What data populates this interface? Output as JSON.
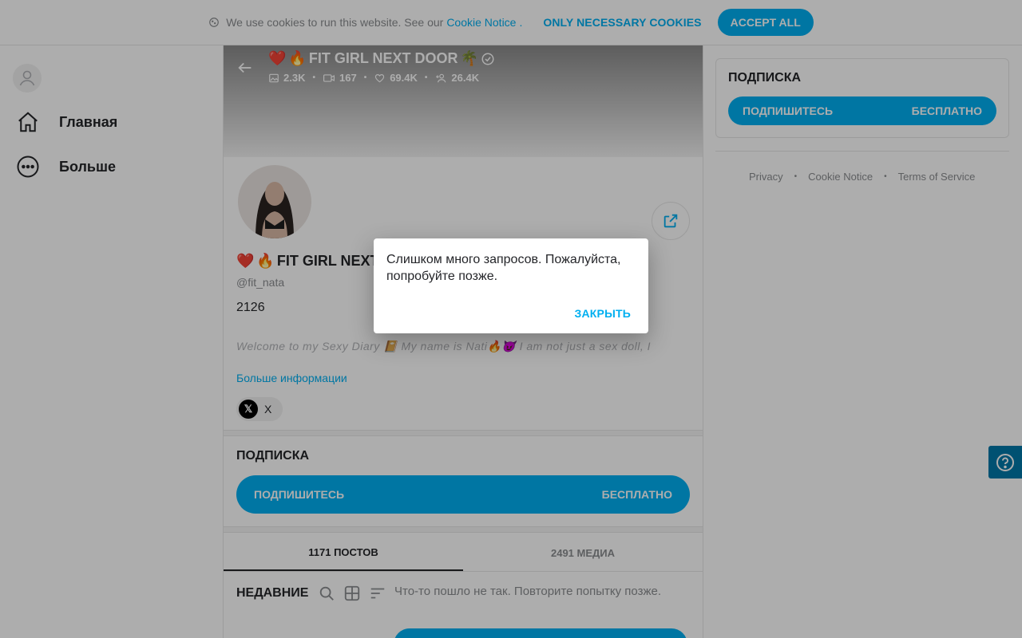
{
  "cookie_bar": {
    "text": "We use cookies to run this website. See our",
    "link": "Cookie Notice",
    "dot": ".",
    "necessary": "ONLY NECESSARY COOKIES",
    "accept": "ACCEPT ALL"
  },
  "sidebar": {
    "items": [
      {
        "label": "Главная",
        "icon": "home-icon"
      },
      {
        "label": "Больше",
        "icon": "more-dots-icon"
      }
    ]
  },
  "profile": {
    "banner_title": "FIT GIRL NEXT DOOR",
    "stats": {
      "photos": "2.3K",
      "videos": "167",
      "likes": "69.4K",
      "fans": "26.4K"
    },
    "name": "FIT GIRL NEXT",
    "handle": "@fit_nata",
    "count": "2126",
    "bio": "Welcome to my Sexy Diary 📔 My name is Nati🔥😈 I am not just a sex doll, I",
    "more_info": "Больше информации",
    "social_label": "X"
  },
  "subscription": {
    "heading": "ПОДПИСКА",
    "button_label": "ПОДПИШИТЕСЬ",
    "button_price": "БЕСПЛАТНО"
  },
  "tabs": [
    {
      "label": "1171 ПОСТОВ",
      "active": true
    },
    {
      "label": "2491 МЕДИА",
      "active": false
    }
  ],
  "feed": {
    "label": "НЕДАВНИЕ",
    "error": "Что-то пошло не так. Повторите попытку позже."
  },
  "right_panel": {
    "heading": "ПОДПИСКА",
    "button_label": "ПОДПИШИТЕСЬ",
    "button_price": "БЕСПЛАТНО",
    "footer_links": [
      "Privacy",
      "Cookie Notice",
      "Terms of Service"
    ]
  },
  "dialog": {
    "message": "Слишком много запросов. Пожалуйста, попробуйте позже.",
    "close": "ЗАКРЫТЬ"
  },
  "colors": {
    "accent": "#00aff0",
    "help_tab": "#0078a8"
  }
}
